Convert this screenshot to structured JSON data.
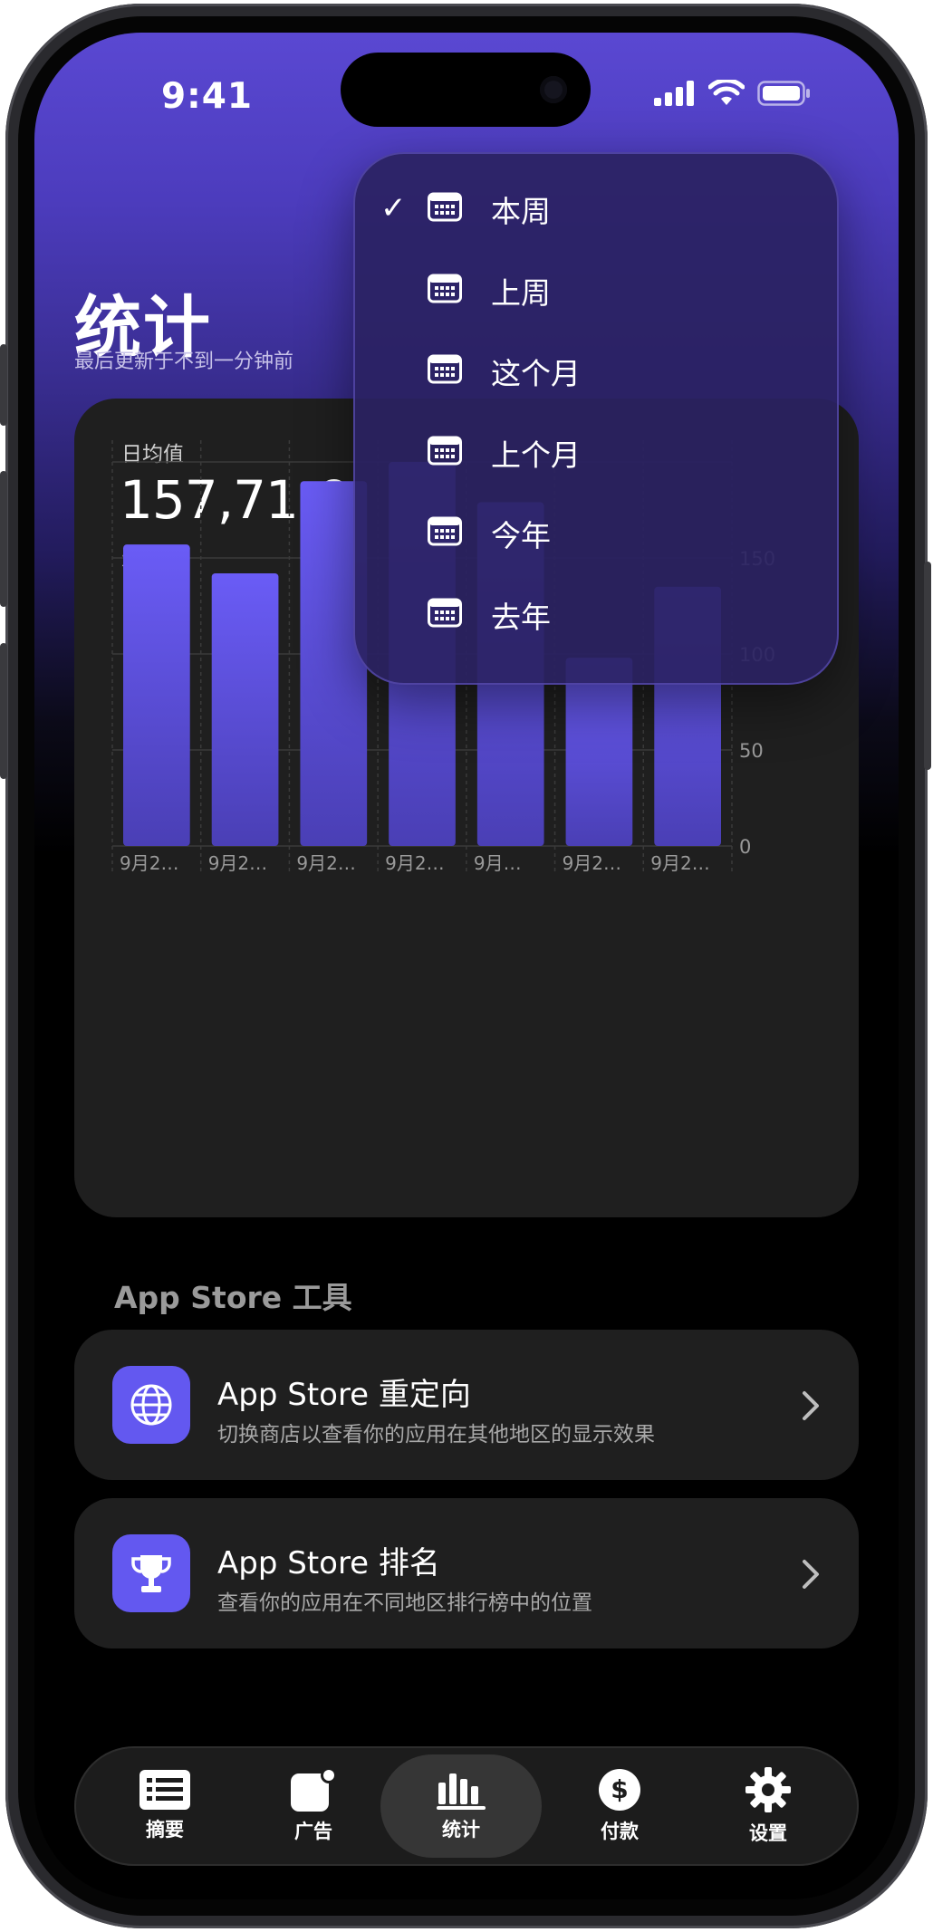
{
  "status_bar": {
    "time": "9:41"
  },
  "header": {
    "title": "统计",
    "subtitle": "最后更新于不到一分钟前"
  },
  "summary": {
    "label": "日均值",
    "value": "157,71 €",
    "period": "本周"
  },
  "chart_data": {
    "type": "bar",
    "categories": [
      "9月2…",
      "9月2…",
      "9月2…",
      "9月2…",
      "9月…",
      "9月2…",
      "9月2…"
    ],
    "values": [
      157,
      142,
      190,
      200,
      179,
      98,
      135
    ],
    "yticks": [
      0,
      50,
      100,
      150
    ],
    "ylim": [
      0,
      200
    ],
    "colors": {
      "bar_top": "#6a5cf6",
      "bar_bottom": "#4a3fb5"
    }
  },
  "dropdown": {
    "items": [
      {
        "label": "本周",
        "checked": "✓"
      },
      {
        "label": "上周",
        "checked": ""
      },
      {
        "label": "这个月",
        "checked": ""
      },
      {
        "label": "上个月",
        "checked": ""
      },
      {
        "label": "今年",
        "checked": ""
      },
      {
        "label": "去年",
        "checked": ""
      }
    ]
  },
  "tools": {
    "section_title": "App Store 工具",
    "items": [
      {
        "title": "App Store 重定向",
        "desc": "切换商店以查看你的应用在其他地区的显示效果",
        "icon": "globe-icon"
      },
      {
        "title": "App Store 排名",
        "desc": "查看你的应用在不同地区排行榜中的位置",
        "icon": "trophy-icon"
      }
    ]
  },
  "tabbar": {
    "tabs": [
      {
        "label": "摘要",
        "icon": "list-icon"
      },
      {
        "label": "广告",
        "icon": "ads-icon"
      },
      {
        "label": "统计",
        "icon": "chart-icon",
        "active": true
      },
      {
        "label": "付款",
        "icon": "dollar-icon"
      },
      {
        "label": "设置",
        "icon": "gear-icon"
      }
    ]
  },
  "colors": {
    "accent": "#6358f0",
    "card": "#1f1f1f"
  }
}
